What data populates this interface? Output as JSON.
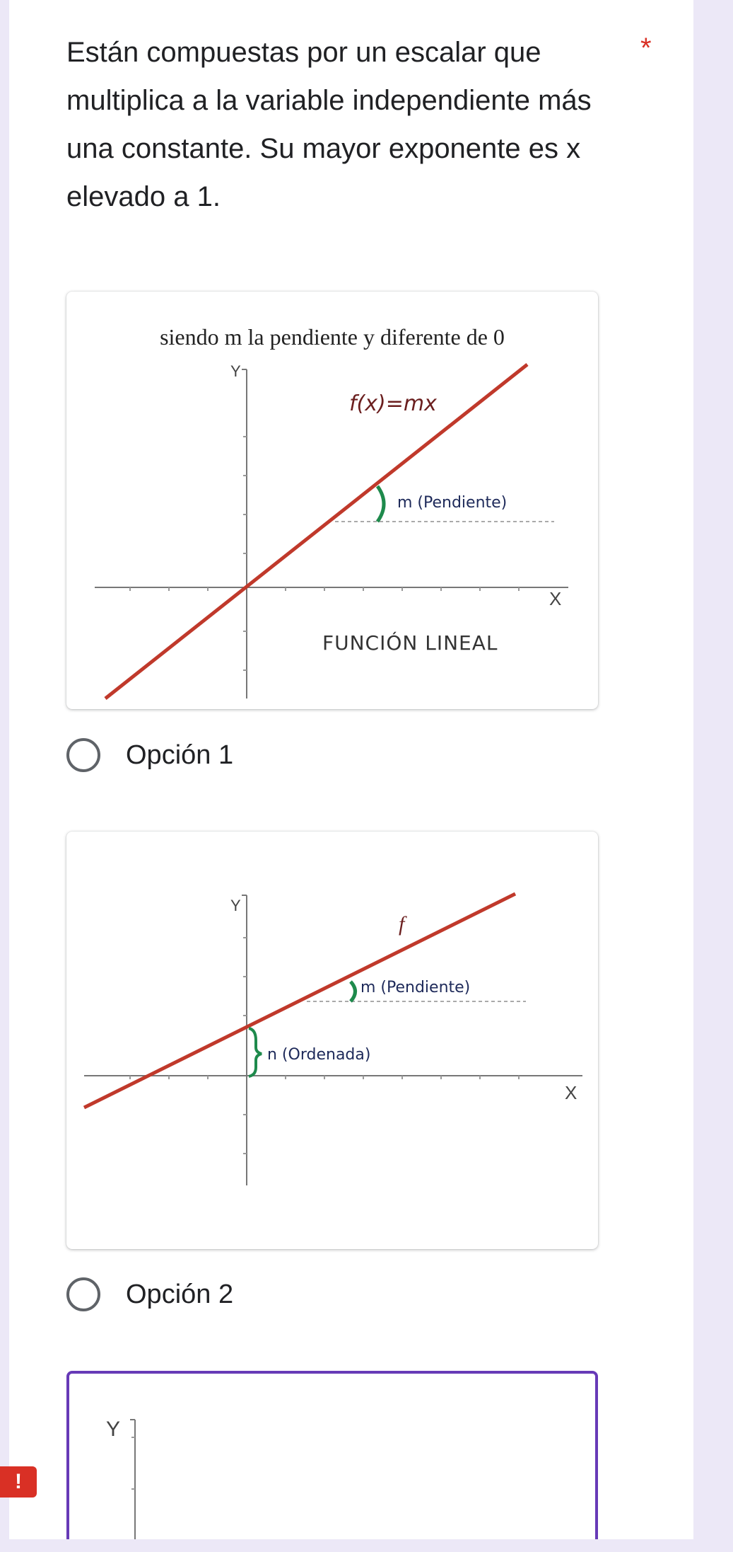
{
  "question": {
    "text": "Están compuestas por un escalar que multiplica a la variable independiente más una constante. Su mayor exponente es x elevado a 1.",
    "required_marker": "*"
  },
  "image1": {
    "caption": "siendo m la pendiente y diferente de 0",
    "y_label": "Y",
    "x_label": "X",
    "formula": "f(x)=mx",
    "slope_label": "m (Pendiente)",
    "title": "FUNCIÓN LINEAL"
  },
  "option1": {
    "label": "Opción 1"
  },
  "image2": {
    "y_label": "Y",
    "x_label": "X",
    "f_label": "f",
    "slope_label": "m (Pendiente)",
    "intercept_label": "n (Ordenada)"
  },
  "option2": {
    "label": "Opción 2"
  },
  "image3": {
    "y_label": "Y"
  },
  "error_badge": "!",
  "colors": {
    "accent": "#673ab7",
    "line": "#c0392b",
    "green": "#1e8a4c",
    "required": "#d93025"
  }
}
